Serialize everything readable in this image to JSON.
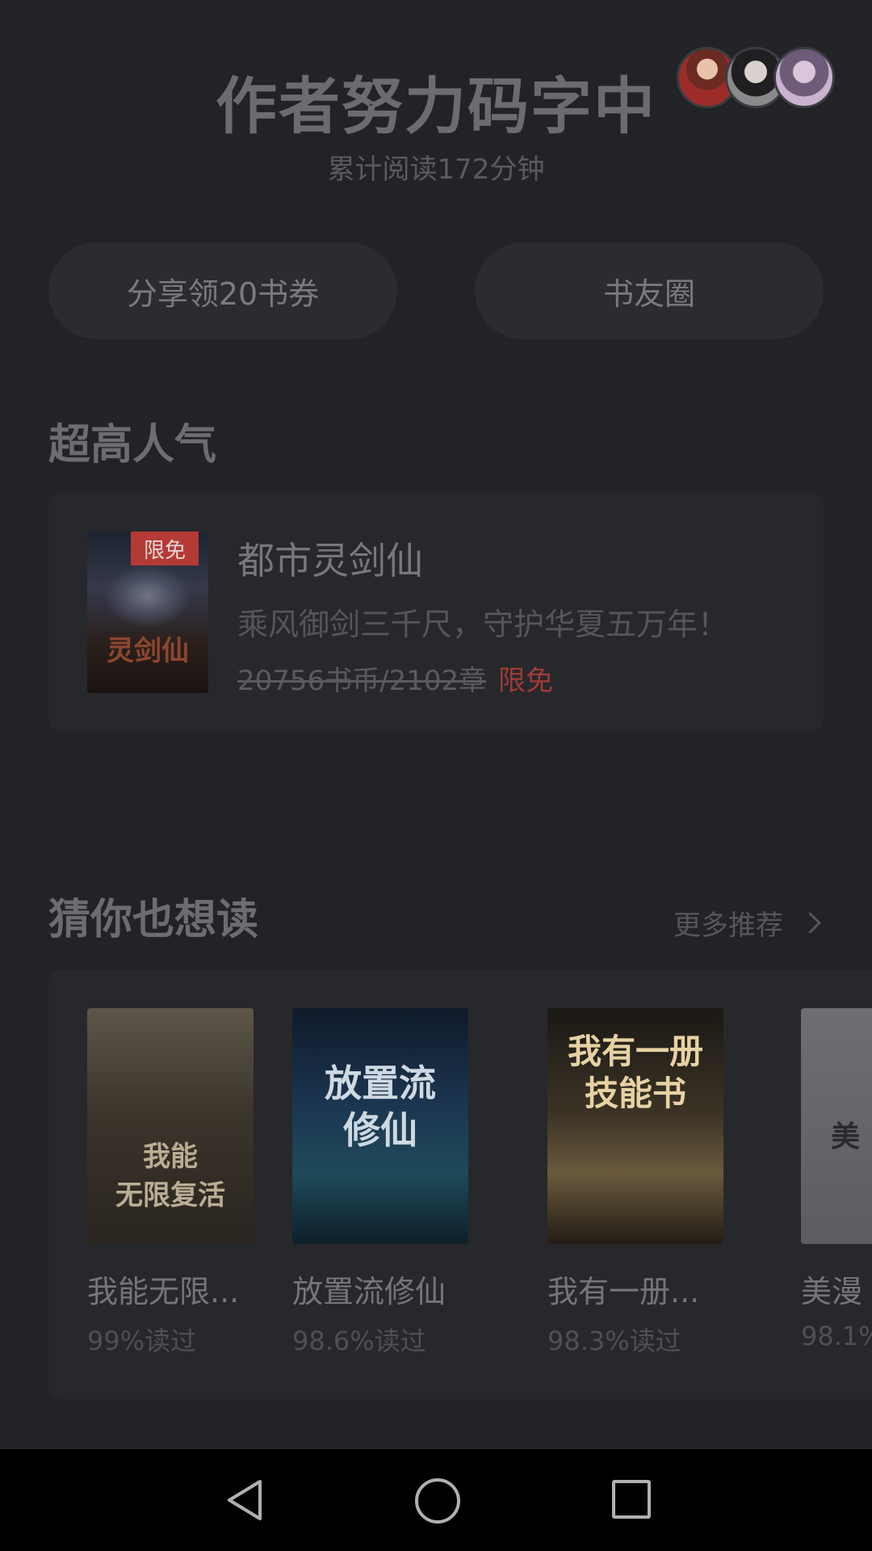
{
  "header": {
    "title": "作者努力码字中",
    "reading_stat": "累计阅读172分钟"
  },
  "actions": {
    "share_coupon": "分享领20书券",
    "book_circle": "书友圈"
  },
  "popular": {
    "section_title": "超高人气",
    "book": {
      "badge": "限免",
      "cover_text": "灵剑仙",
      "title": "都市灵剑仙",
      "description": "乘风御剑三千尺，守护华夏五万年！",
      "price": "20756书币/2102章",
      "free_tag": "限免"
    }
  },
  "recommend": {
    "section_title": "猜你也想读",
    "more_label": "更多推荐",
    "books": [
      {
        "cover_text": "我能\n无限复活",
        "title": "我能无限...",
        "stat": "99%读过"
      },
      {
        "cover_text": "放置流\n修仙",
        "title": "放置流修仙",
        "stat": "98.6%读过"
      },
      {
        "cover_text": "我有一册\n技能书",
        "title": "我有一册...",
        "stat": "98.3%读过"
      },
      {
        "cover_text": "美",
        "title": "美漫",
        "stat": "98.1%"
      }
    ]
  },
  "colors": {
    "background": "#222326",
    "card": "#27282b",
    "accent_red": "#b53a35"
  },
  "icons": {
    "nav_back": "back-triangle-icon",
    "nav_home": "home-circle-icon",
    "nav_recent": "recent-square-icon"
  }
}
